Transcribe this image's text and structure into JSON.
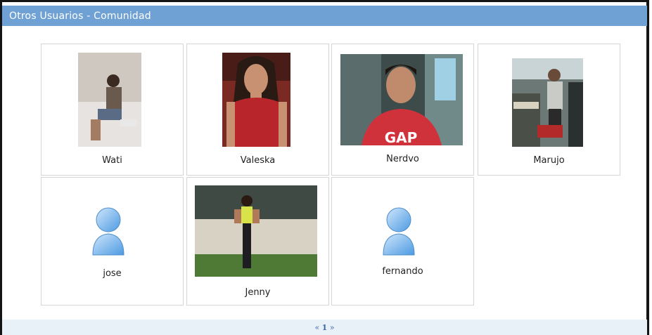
{
  "header": {
    "title": "Otros Usuarios - Comunidad"
  },
  "users": [
    {
      "name": "Wati",
      "photo": "photo"
    },
    {
      "name": "Valeska",
      "photo": "photo"
    },
    {
      "name": "Nerdvo",
      "photo": "photo"
    },
    {
      "name": "Marujo",
      "photo": "photo"
    },
    {
      "name": "jose",
      "photo": "default-avatar"
    },
    {
      "name": "Jenny",
      "photo": "photo"
    },
    {
      "name": "fernando",
      "photo": "default-avatar"
    }
  ],
  "pagination": {
    "prev": "«",
    "current": "1",
    "next": "»"
  },
  "colors": {
    "header_bg": "#6fa1d4",
    "footer_bg": "#e8f0f8",
    "link": "#3a6aa8"
  }
}
